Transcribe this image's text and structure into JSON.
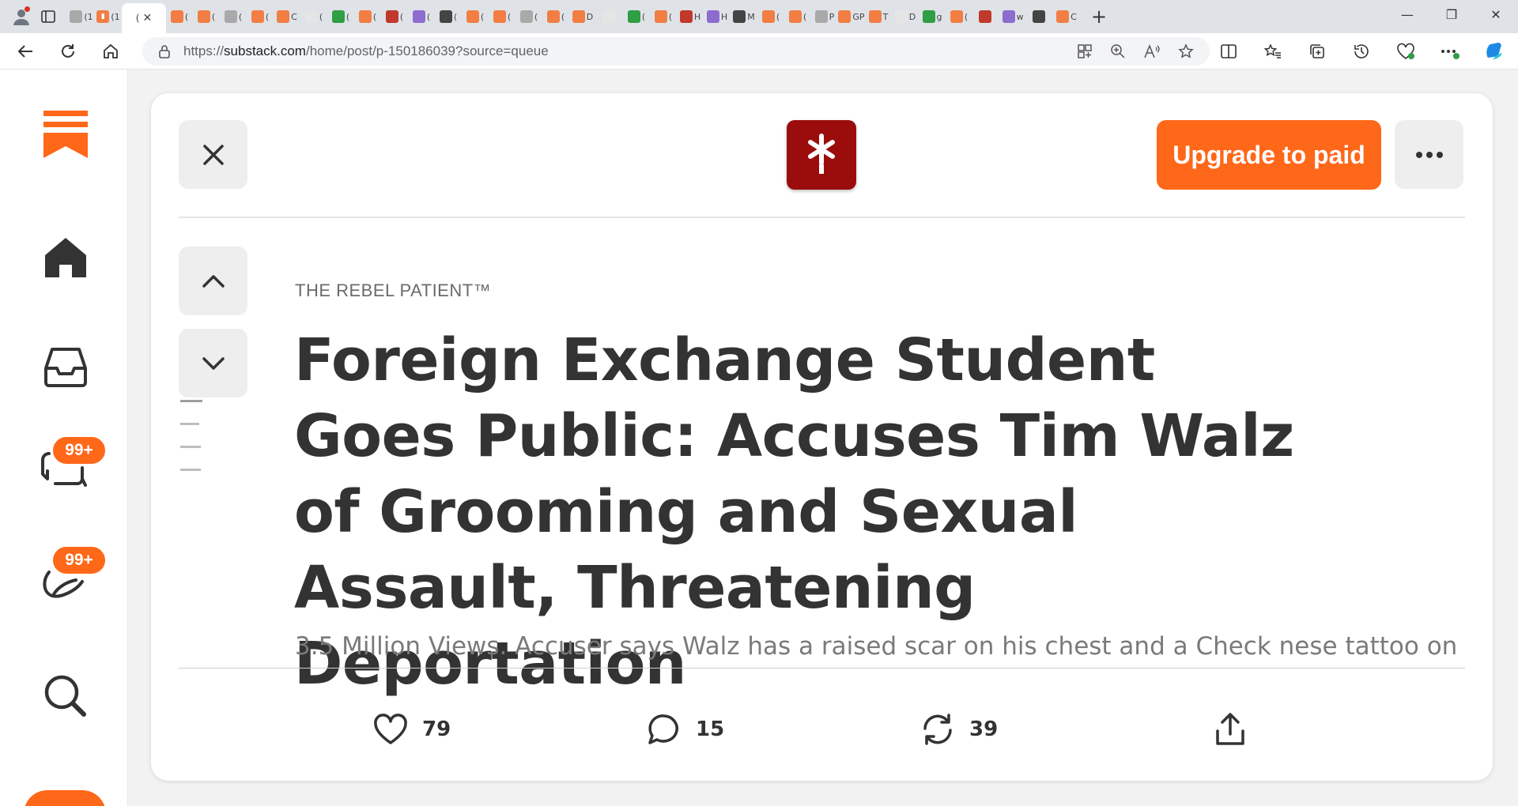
{
  "browser": {
    "active_tab_label": "(",
    "url_scheme": "https://",
    "url_host": "substack.com",
    "url_path": "/home/post/p-150186039?source=queue",
    "tab_glyphs": [
      "(1",
      "(",
      "(",
      "(",
      "(",
      "(",
      "(",
      "C",
      "(",
      "(",
      "(",
      "(",
      "(",
      "(",
      "(",
      "(",
      "(",
      "(",
      "D",
      "",
      "(",
      "(",
      "H",
      "H",
      "M",
      "(",
      "(",
      "P",
      "GP",
      "T",
      "D",
      "g",
      "(",
      "",
      "w",
      "",
      "C"
    ]
  },
  "sidebar": {
    "inbox_badge": "99+",
    "activity_badge": "99+"
  },
  "post": {
    "publication_name": "THE REBEL PATIENT™",
    "title": "Foreign Exchange Student Goes Public: Accuses Tim Walz of Grooming and Sexual Assault, Threatening Deportation",
    "subtitle": "3.5 Million Views. Accuser says Walz has a raised scar on his chest and a Check nese tattoo on",
    "upgrade_label": "Upgrade to paid",
    "likes": "79",
    "comments": "15",
    "restacks": "39"
  },
  "colors": {
    "accent": "#ff6719",
    "logo_bg": "#9b0d0d",
    "text_dark": "#333333"
  },
  "icons": [
    "close-icon",
    "chevron-up-icon",
    "chevron-down-icon",
    "more-icon",
    "heart-icon",
    "comment-icon",
    "restack-icon",
    "share-icon",
    "home-icon",
    "inbox-icon",
    "chat-icon",
    "activity-icon",
    "search-icon"
  ]
}
